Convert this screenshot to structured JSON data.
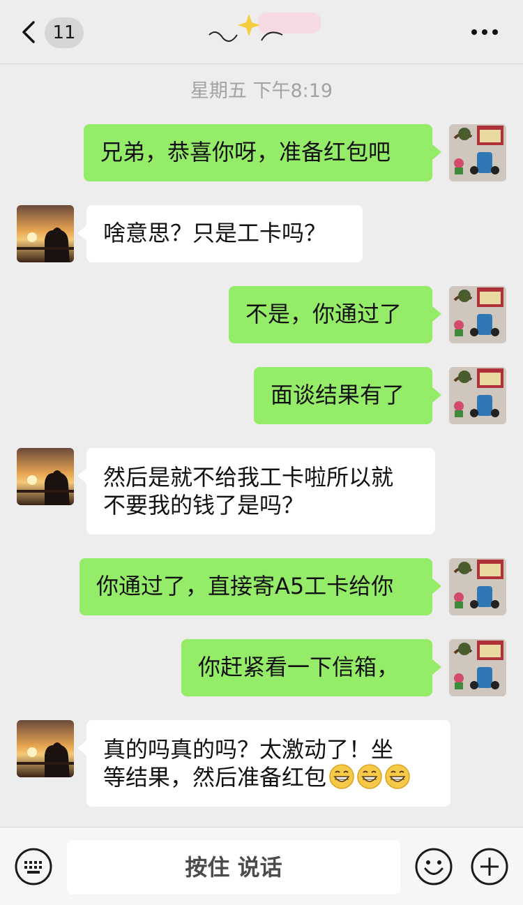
{
  "header": {
    "unread_count": "11"
  },
  "timestamp": "星期五 下午8:19",
  "messages": [
    {
      "side": "out",
      "text": "兄弟，恭喜你呀，准备红包吧"
    },
    {
      "side": "in",
      "text": "啥意思？只是工卡吗？"
    },
    {
      "side": "out",
      "text": "不是，你通过了"
    },
    {
      "side": "out",
      "text": "面谈结果有了"
    },
    {
      "side": "in",
      "text": "然后是就不给我工卡啦所以就\n不要我的钱了是吗？"
    },
    {
      "side": "out",
      "text": "你通过了，直接寄A5工卡给你"
    },
    {
      "side": "out",
      "text": "你赶紧看一下信箱，"
    },
    {
      "side": "in",
      "text": "真的吗真的吗？太激动了！坐\n等结果，然后准备红包"
    }
  ],
  "emoji": [
    "grinning-face-icon",
    "grinning-face-icon",
    "grinning-face-icon"
  ],
  "bottom_bar": {
    "voice_label": "按住 说话"
  },
  "colors": {
    "outgoing_bubble": "#95ec69",
    "incoming_bubble": "#ffffff",
    "background": "#ededed"
  }
}
